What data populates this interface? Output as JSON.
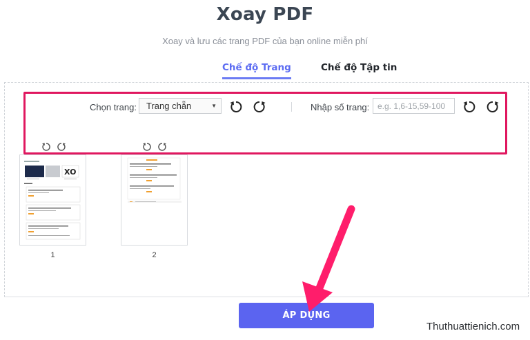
{
  "header": {
    "title": "Xoay PDF",
    "subtitle": "Xoay và lưu các trang PDF của bạn online miễn phí"
  },
  "tabs": [
    {
      "label": "Chế độ Trang",
      "active": true
    },
    {
      "label": "Chế độ Tập tin",
      "active": false
    }
  ],
  "toolbar": {
    "choose_label": "Chọn trang:",
    "choose_value": "Trang chẵn",
    "enter_label": "Nhập số trang:",
    "page_input_placeholder": "e.g. 1,6-15,59-100"
  },
  "pages": [
    {
      "number": "1"
    },
    {
      "number": "2"
    }
  ],
  "apply_label": "ÁP DỤNG",
  "watermark": "Thuthuattienich.com",
  "colors": {
    "accent": "#5b64f0",
    "highlight": "#e0175f",
    "active_tab": "#5c6cf2"
  }
}
